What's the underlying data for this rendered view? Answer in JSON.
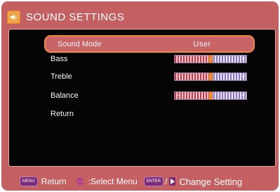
{
  "title": "SOUND SETTINGS",
  "icons": {
    "title": "speaker-icon",
    "updown": "up-down-arrows-icon",
    "right": "right-arrow-icon"
  },
  "colors": {
    "frame": "#c56062",
    "panel": "#050505",
    "highlight": "#f08a3a",
    "knob": "#f08d3c"
  },
  "menu": {
    "sound_mode": {
      "label": "Sound Mode",
      "value": "User"
    },
    "bass": {
      "label": "Bass",
      "level": 0.5
    },
    "treble": {
      "label": "Treble",
      "level": 0.5
    },
    "balance": {
      "label": "Balance",
      "level": 0.5
    },
    "return": {
      "label": "Return"
    }
  },
  "footer": {
    "menu_key": "MENU",
    "return_label": "Return",
    "select_label": ":Select Menu",
    "enter_key": "ENTER",
    "slash": "/",
    "change_label": "Change Setting"
  }
}
